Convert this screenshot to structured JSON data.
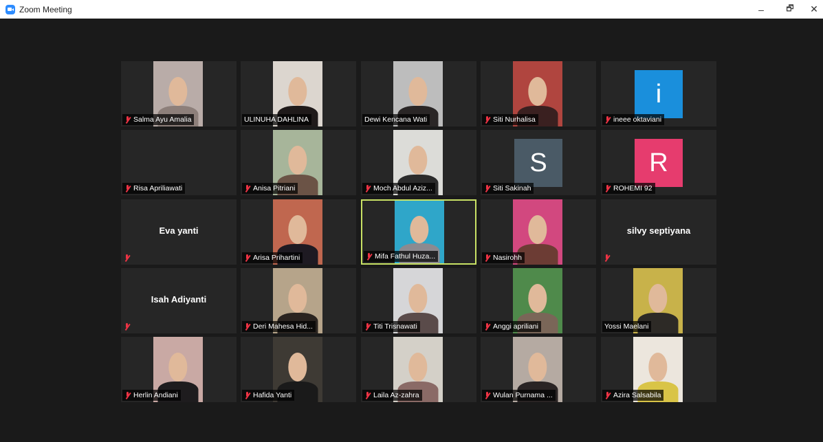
{
  "window": {
    "title": "Zoom Meeting",
    "minimize": "–",
    "maximize": "🗗",
    "close": "✕"
  },
  "tiles": [
    {
      "name": "Salma Ayu Amalia",
      "muted": true,
      "kind": "video",
      "bg": "#b9aca8",
      "tone": "#8d7f7a"
    },
    {
      "name": "ULINUHA DAHLINA",
      "muted": false,
      "kind": "video",
      "bg": "#dcd6cf",
      "tone": "#1f1a1a"
    },
    {
      "name": "Dewi Kencana Wati",
      "muted": false,
      "kind": "video",
      "bg": "#bdbdbd",
      "tone": "#2a2626"
    },
    {
      "name": "Siti Nurhalisa",
      "muted": true,
      "kind": "video",
      "bg": "#b0453f",
      "tone": "#3a2020"
    },
    {
      "name": "ineee oktaviani",
      "muted": true,
      "kind": "avatar",
      "letter": "i",
      "color": "#1a8fdc"
    },
    {
      "name": "Risa Apriliawati",
      "muted": true,
      "kind": "blank"
    },
    {
      "name": "Anisa Pitriani",
      "muted": true,
      "kind": "video",
      "bg": "#a7b59a",
      "tone": "#6b5346"
    },
    {
      "name": "Moch Abdul Aziz...",
      "muted": true,
      "kind": "video",
      "bg": "#dcdcd8",
      "tone": "#2b2b2b"
    },
    {
      "name": "Siti Sakinah",
      "muted": true,
      "kind": "avatar",
      "letter": "S",
      "color": "#4a5a66"
    },
    {
      "name": "ROHEMI 92",
      "muted": true,
      "kind": "avatar",
      "letter": "R",
      "color": "#e63c6e"
    },
    {
      "name": "Eva yanti",
      "muted": true,
      "kind": "nameonly"
    },
    {
      "name": "Arisa Prihartini",
      "muted": true,
      "kind": "video",
      "bg": "#c0674f",
      "tone": "#1e1a22"
    },
    {
      "name": "Mifa Fathul Huza...",
      "muted": true,
      "kind": "video",
      "bg": "#2fa6c9",
      "tone": "#8c8a90",
      "active": true
    },
    {
      "name": "Nasirohh",
      "muted": true,
      "kind": "video",
      "bg": "#d2487f",
      "tone": "#6c3c34"
    },
    {
      "name": "silvy septiyana",
      "muted": true,
      "kind": "nameonly"
    },
    {
      "name": "Isah Adiyanti",
      "muted": true,
      "kind": "nameonly"
    },
    {
      "name": "Deri Mahesa Hid...",
      "muted": true,
      "kind": "video",
      "bg": "#b6a48a",
      "tone": "#2a2420"
    },
    {
      "name": "Titi Trisnawati",
      "muted": true,
      "kind": "video",
      "bg": "#d6d6d8",
      "tone": "#5a4b4a"
    },
    {
      "name": "Anggi apriliani",
      "muted": true,
      "kind": "video",
      "bg": "#4f8a4b",
      "tone": "#7a6658"
    },
    {
      "name": "Yossi Maelani",
      "muted": false,
      "kind": "video",
      "bg": "#c8b24a",
      "tone": "#2d2a26"
    },
    {
      "name": "Herlin Andiani",
      "muted": true,
      "kind": "video",
      "bg": "#c9a9a4",
      "tone": "#1e1c1e"
    },
    {
      "name": "Hafida Yanti",
      "muted": true,
      "kind": "video",
      "bg": "#3e3a34",
      "tone": "#1a1a1a"
    },
    {
      "name": "Laila Az-zahra",
      "muted": true,
      "kind": "video",
      "bg": "#d4d0c8",
      "tone": "#8a6a66"
    },
    {
      "name": "Wulan Purnama ...",
      "muted": true,
      "kind": "video",
      "bg": "#b5aaa2",
      "tone": "#2a2424"
    },
    {
      "name": "Azira Salsabila",
      "muted": true,
      "kind": "video",
      "bg": "#ece6dd",
      "tone": "#d9c447"
    }
  ]
}
